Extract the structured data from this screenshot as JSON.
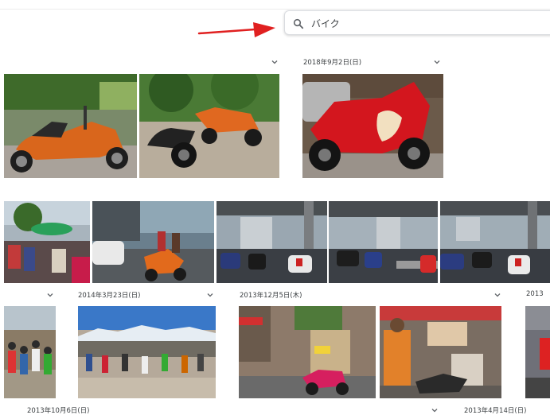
{
  "search": {
    "query": "バイク",
    "icon": "search-icon"
  },
  "annotation": {
    "arrow_color": "#e02020"
  },
  "groups": [
    {
      "id": "g-unlabeled-1",
      "date": "",
      "photos": [
        "orange-trike",
        "black-and-orange-bikes"
      ]
    },
    {
      "id": "g-2018-09-02",
      "date": "2018年9月2日(日)",
      "photos": [
        "red-sport-bike"
      ]
    },
    {
      "id": "g-unlabeled-2",
      "date": "",
      "photos": [
        "street-crowd-umbrellas",
        "scooter-street"
      ]
    },
    {
      "id": "g-2014-03-23",
      "date": "2014年3月23日(日)",
      "photos": [
        "parked-motorbikes-1",
        "parked-motorbikes-2",
        "parked-motorbikes-3"
      ]
    },
    {
      "id": "g-2013-12-05",
      "date": "2013年12月5日(木)",
      "photos": [
        "street-scene",
        "food-stall"
      ]
    },
    {
      "id": "g-2013-10-06",
      "date": "2013年10月6日(日)",
      "photos": [
        "outdoor-crowd",
        "snowy-mountain-gathering"
      ]
    },
    {
      "id": "g-2013-04-14",
      "date": "2013年4月14日(日)",
      "photos": [
        "shop-street-scooters"
      ]
    },
    {
      "id": "g-2013-cut",
      "date": "2013",
      "photos": [
        "edge-photo"
      ]
    }
  ]
}
